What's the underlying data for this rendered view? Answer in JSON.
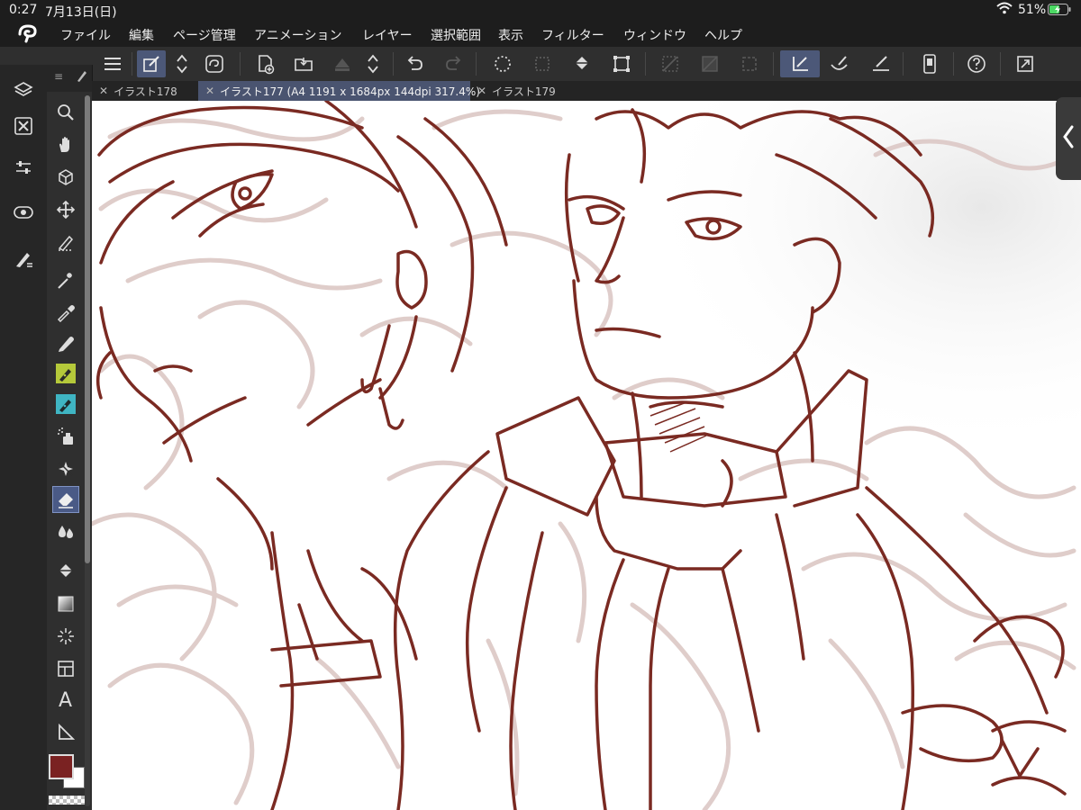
{
  "status": {
    "time": "0:27",
    "date": "7月13日(日)",
    "battery": "51%"
  },
  "menu": {
    "items": [
      "ファイル",
      "編集",
      "ページ管理",
      "アニメーション",
      "レイヤー",
      "選択範囲",
      "表示",
      "フィルター",
      "ウィンドウ",
      "ヘルプ"
    ]
  },
  "tabs": [
    {
      "label": "イラスト178",
      "active": false
    },
    {
      "label": "イラスト177 (A4 1191 x 1684px 144dpi 317.4%)",
      "active": true
    },
    {
      "label": "イラスト179",
      "active": false
    }
  ],
  "colors": {
    "main": "#7a2222",
    "sub": "#ffffff",
    "accent": "#4a5a86",
    "lineart": "#7a2a22",
    "sketch": "#d9c5c2"
  },
  "tools": [
    "zoom-icon",
    "hand-icon",
    "rotate-view-icon",
    "move-icon",
    "operation-icon",
    "magic-wand-icon",
    "eyedropper-icon",
    "pencil-icon",
    "pen-icon",
    "brush-icon",
    "airbrush-icon",
    "decoration-icon",
    "eraser-icon",
    "blend-icon",
    "fill-icon",
    "gradient-icon",
    "figure-icon",
    "frame-icon",
    "text-icon",
    "ruler-icon"
  ]
}
